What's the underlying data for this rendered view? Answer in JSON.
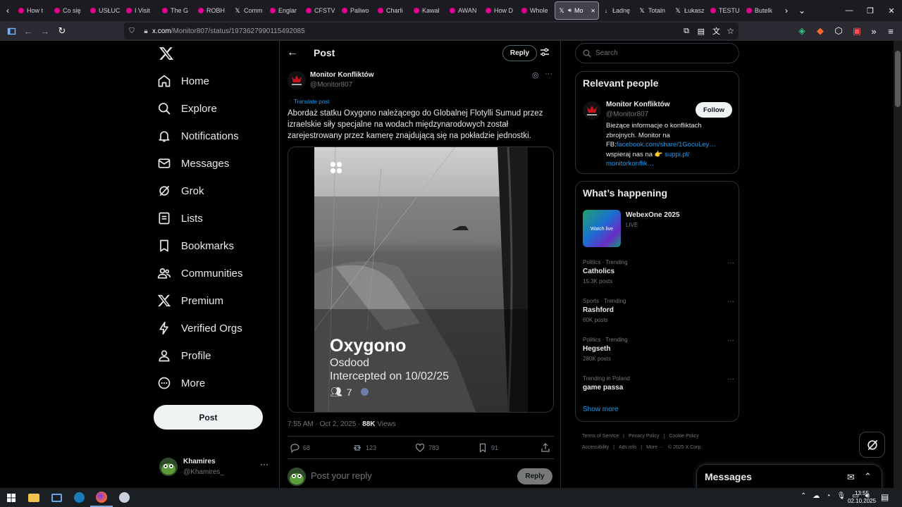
{
  "browser": {
    "tabs": [
      {
        "title": "How t",
        "fav": "#e3008c"
      },
      {
        "title": "Co się",
        "fav": "#e3008c"
      },
      {
        "title": "USŁUC",
        "fav": "#e3008c"
      },
      {
        "title": "I Visit",
        "fav": "#e3008c"
      },
      {
        "title": "The G",
        "fav": "#e3008c"
      },
      {
        "title": "ROBH",
        "fav": "#e3008c"
      },
      {
        "title": "Comm",
        "fav": "x"
      },
      {
        "title": "Englar",
        "fav": "#e3008c"
      },
      {
        "title": "CFSTV",
        "fav": "#e3008c"
      },
      {
        "title": "Paliwo",
        "fav": "#e3008c"
      },
      {
        "title": "Charli",
        "fav": "#e3008c"
      },
      {
        "title": "Kawal",
        "fav": "#e3008c"
      },
      {
        "title": "AWAN",
        "fav": "#e3008c"
      },
      {
        "title": "How D",
        "fav": "#e3008c"
      },
      {
        "title": "Whole",
        "fav": "#e3008c"
      },
      {
        "title": "Mo",
        "fav": "x",
        "active": true
      },
      {
        "title": "Ładnę",
        "fav": "arrow"
      },
      {
        "title": "Totaln",
        "fav": "x"
      },
      {
        "title": "Łukasz",
        "fav": "x"
      },
      {
        "title": "TESTU",
        "fav": "#e3008c"
      },
      {
        "title": "Butelk",
        "fav": "#e3008c"
      }
    ],
    "url_host": "x.com",
    "url_path": "/Monitor807/status/1973627990115492085"
  },
  "nav": {
    "home": "Home",
    "explore": "Explore",
    "notifications": "Notifications",
    "messages": "Messages",
    "grok": "Grok",
    "lists": "Lists",
    "bookmarks": "Bookmarks",
    "communities": "Communities",
    "premium": "Premium",
    "verified_orgs": "Verified Orgs",
    "profile": "Profile",
    "more": "More",
    "post_button": "Post"
  },
  "account": {
    "name": "Khamires",
    "handle": "@Khamires_"
  },
  "post_header": {
    "title": "Post",
    "reply_button": "Reply"
  },
  "post": {
    "author_name": "Monitor Konfliktów",
    "author_handle": "@Monitor807",
    "translate": "Translate post",
    "text": "Abordaż statku Oxygono należącego do Globalnej Flotylli Sumud przez izraelskie siły specjalne na wodach międzynarodowych został zarejestrowany przez kamerę znajdującą się na pokładzie jednostki.",
    "video_title": "Oxygono",
    "video_sub1": "Osdood",
    "video_sub2": "Intercepted on 10/02/25",
    "video_crew": "7",
    "time": "7:55 AM · Oct 2, 2025 · ",
    "views_count": "88K",
    "views_label": " Views",
    "replies": "68",
    "reposts": "123",
    "likes": "783",
    "bookmarks": "91",
    "reply_placeholder": "Post your reply",
    "reply_button": "Reply"
  },
  "search": {
    "placeholder": "Search"
  },
  "relevant": {
    "title": "Relevant people",
    "name": "Monitor Konfliktów",
    "handle": "@Monitor807",
    "follow": "Follow",
    "bio_line1": "Bieżące informacje o konfliktach",
    "bio_line2": "zbrojnych. Monitor na",
    "bio_line3_pre": "FB:",
    "bio_link1": "facebook.com/share/1GocuLey…",
    "bio_line4_pre": "wspieraj nas na 👉 ",
    "bio_link2": "suppi.pl/",
    "bio_link3": "monitorkonflik…"
  },
  "happening": {
    "title": "What’s happening",
    "event_name": "WebexOne 2025",
    "event_status": "LIVE",
    "event_thumb_text": "Watch live",
    "trends": [
      {
        "cat": "Politics · Trending",
        "name": "Catholics",
        "count": "15.3K posts"
      },
      {
        "cat": "Sports · Trending",
        "name": "Rashford",
        "count": "60K posts"
      },
      {
        "cat": "Politics · Trending",
        "name": "Hegseth",
        "count": "280K posts"
      },
      {
        "cat": "Trending in Poland",
        "name": "game passa",
        "count": ""
      }
    ],
    "show_more": "Show more"
  },
  "footer": {
    "links": [
      "Terms of Service",
      "Privacy Policy",
      "Cookie Policy",
      "Accessibility",
      "Ads info",
      "More ···",
      "© 2025 X Corp."
    ]
  },
  "messages_drawer": {
    "title": "Messages"
  },
  "taskbar": {
    "time": "13:55",
    "date": "02.10.2025"
  },
  "colors": {
    "accent": "#1d9bf0",
    "background": "#000000",
    "border": "#2f3336",
    "muted": "#71767b"
  }
}
